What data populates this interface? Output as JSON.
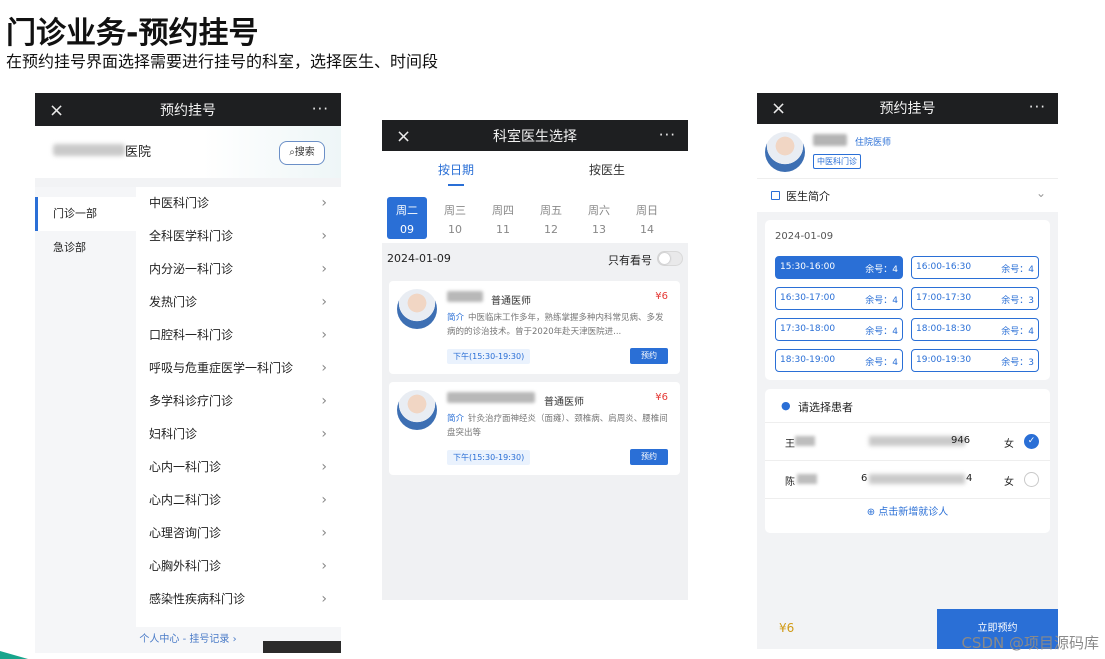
{
  "slide": {
    "title": "门诊业务-预约挂号",
    "subtitle": "在预约挂号界面选择需要进行挂号的科室，选择医生、时间段",
    "watermark": "CSDN @项目源码库"
  },
  "phone1": {
    "title": "预约挂号",
    "close_icon": "×",
    "more_icon": "···",
    "hospital_name_suffix": "医院",
    "search_label": "搜索",
    "categories": [
      "门诊一部",
      "急诊部"
    ],
    "departments": [
      "中医科门诊",
      "全科医学科门诊",
      "内分泌一科门诊",
      "发热门诊",
      "口腔科一科门诊",
      "呼吸与危重症医学一科门诊",
      "多学科诊疗门诊",
      "妇科门诊",
      "心内一科门诊",
      "心内二科门诊",
      "心理咨询门诊",
      "心胸外科门诊",
      "感染性疾病科门诊"
    ],
    "footer_link": "个人中心 - 挂号记录 ›"
  },
  "phone2": {
    "title": "科室医生选择",
    "close_icon": "×",
    "more_icon": "···",
    "tabs": [
      "按日期",
      "按医生"
    ],
    "days": [
      {
        "week": "周二",
        "date": "09"
      },
      {
        "week": "周三",
        "date": "10"
      },
      {
        "week": "周四",
        "date": "11"
      },
      {
        "week": "周五",
        "date": "12"
      },
      {
        "week": "周六",
        "date": "13"
      },
      {
        "week": "周日",
        "date": "14"
      }
    ],
    "date": "2024-01-09",
    "only_available": "只有看号",
    "doctors": [
      {
        "role": "普通医师",
        "price": "¥6",
        "intro_label": "简介",
        "intro": "中医临床工作多年，熟练掌握多种内科常见病、多发病的的诊治技术。曾于2020年赴天津医院进...",
        "slot": "下午(15:30-19:30)",
        "book": "预约"
      },
      {
        "role": "普通医师",
        "price": "¥6",
        "intro_label": "简介",
        "intro": "针灸治疗面神经炎（面瘫）、颈椎病、肩周炎、腰椎间盘突出等",
        "slot": "下午(15:30-19:30)",
        "book": "预约"
      }
    ]
  },
  "phone3": {
    "title": "预约挂号",
    "close_icon": "×",
    "more_icon": "···",
    "doctor_title": "住院医师",
    "doctor_dept": "中医科门诊",
    "intro_header": "医生简介",
    "date": "2024-01-09",
    "slots": [
      {
        "time": "15:30-16:00",
        "remain": "余号：4"
      },
      {
        "time": "16:00-16:30",
        "remain": "余号：4"
      },
      {
        "time": "16:30-17:00",
        "remain": "余号：4"
      },
      {
        "time": "17:00-17:30",
        "remain": "余号：3"
      },
      {
        "time": "17:30-18:00",
        "remain": "余号：4"
      },
      {
        "time": "18:00-18:30",
        "remain": "余号：4"
      },
      {
        "time": "18:30-19:00",
        "remain": "余号：4"
      },
      {
        "time": "19:00-19:30",
        "remain": "余号：3"
      }
    ],
    "patient_header": "请选择患者",
    "patients": [
      {
        "name_visible": "王",
        "id_visible": "946",
        "sex": "女",
        "selected": true
      },
      {
        "name_visible": "陈",
        "id_visible": "6",
        "id_tail": "4",
        "sex": "女",
        "selected": false
      }
    ],
    "add_patient": "⊕ 点击新增就诊人",
    "price": "¥6",
    "book_now": "立即预约"
  }
}
